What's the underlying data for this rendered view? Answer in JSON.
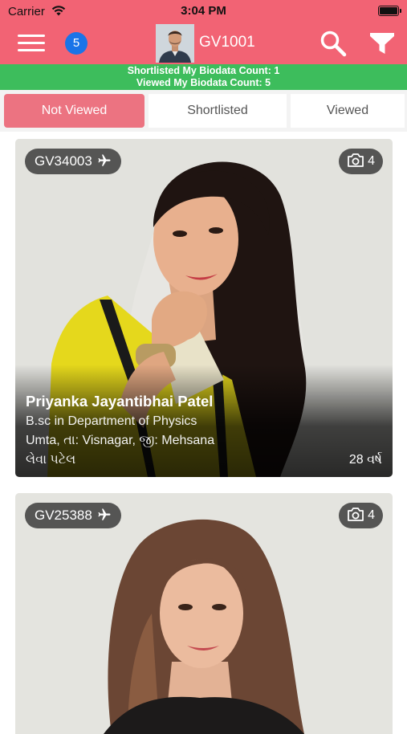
{
  "status_bar": {
    "carrier": "Carrier",
    "time": "3:04 PM"
  },
  "header": {
    "notification_count": "5",
    "profile_id": "GV1001",
    "bar_color": "#f26374",
    "icons": [
      "menu-icon",
      "search-icon",
      "filter-icon"
    ]
  },
  "counts": {
    "shortlisted": "Shortlisted My Biodata Count: 1",
    "viewed": "Viewed My Biodata Count: 5",
    "bar_color": "#3dbd5c"
  },
  "tabs": [
    {
      "label": "Not Viewed",
      "active": true
    },
    {
      "label": "Shortlisted",
      "active": false
    },
    {
      "label": "Viewed",
      "active": false
    }
  ],
  "profiles": [
    {
      "id": "GV34003",
      "photo_count": "4",
      "name": "Priyanka Jayantibhai Patel",
      "education": "B.sc in Department of Physics",
      "location": "Umta, તા: Visnagar, જી: Mehsana",
      "caste": "લેવા પટેલ",
      "age": "28 વર્ષ"
    },
    {
      "id": "GV25388",
      "photo_count": "4"
    }
  ],
  "accent_color": "#ec7381",
  "badge_color": "#1a74e8"
}
